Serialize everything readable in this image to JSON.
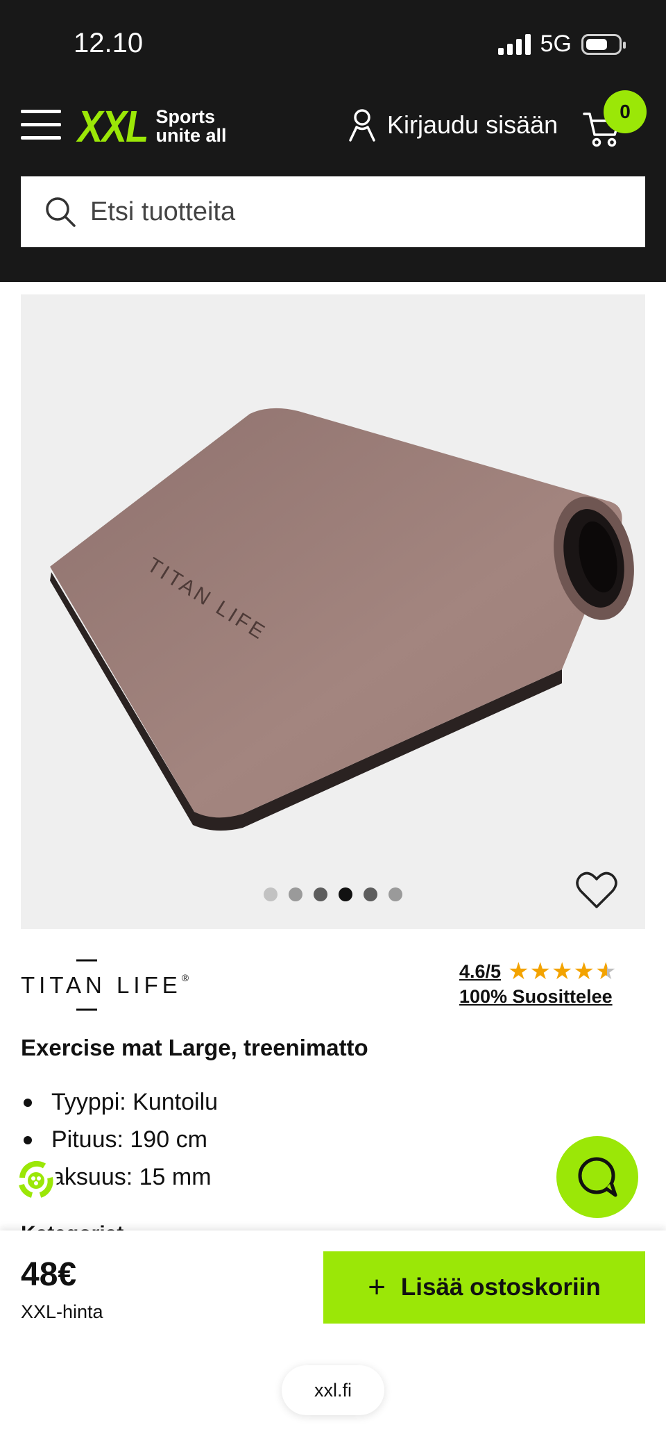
{
  "status_bar": {
    "time": "12.10",
    "network": "5G"
  },
  "header": {
    "logo": "XXL",
    "tagline_line1": "Sports",
    "tagline_line2": "unite all",
    "login_label": "Kirjaudu sisään",
    "cart_count": "0"
  },
  "search": {
    "placeholder": "Etsi tuotteita"
  },
  "gallery": {
    "mat_print": "TITAN LIFE",
    "image_count": 6,
    "active_index": 4
  },
  "product": {
    "brand": "TITAN LIFE",
    "brand_mark": "®",
    "rating": "4.6/5",
    "rating_value": 4.6,
    "recommend": "100% Suosittelee",
    "title": "Exercise mat Large, treenimatto",
    "specs": [
      "Tyyppi: Kuntoilu",
      "Pituus: 190 cm",
      "aksuus: 15 mm"
    ],
    "partial_heading": "Kategoriat"
  },
  "buy_bar": {
    "price": "48€",
    "price_label": "XXL-hinta",
    "add_to_cart": "Lisää ostoskoriin"
  },
  "browser": {
    "url": "xxl.fi"
  },
  "colors": {
    "accent": "#9be707",
    "header_bg": "#181818",
    "star": "#f3a300",
    "gallery_bg": "#efefef"
  }
}
